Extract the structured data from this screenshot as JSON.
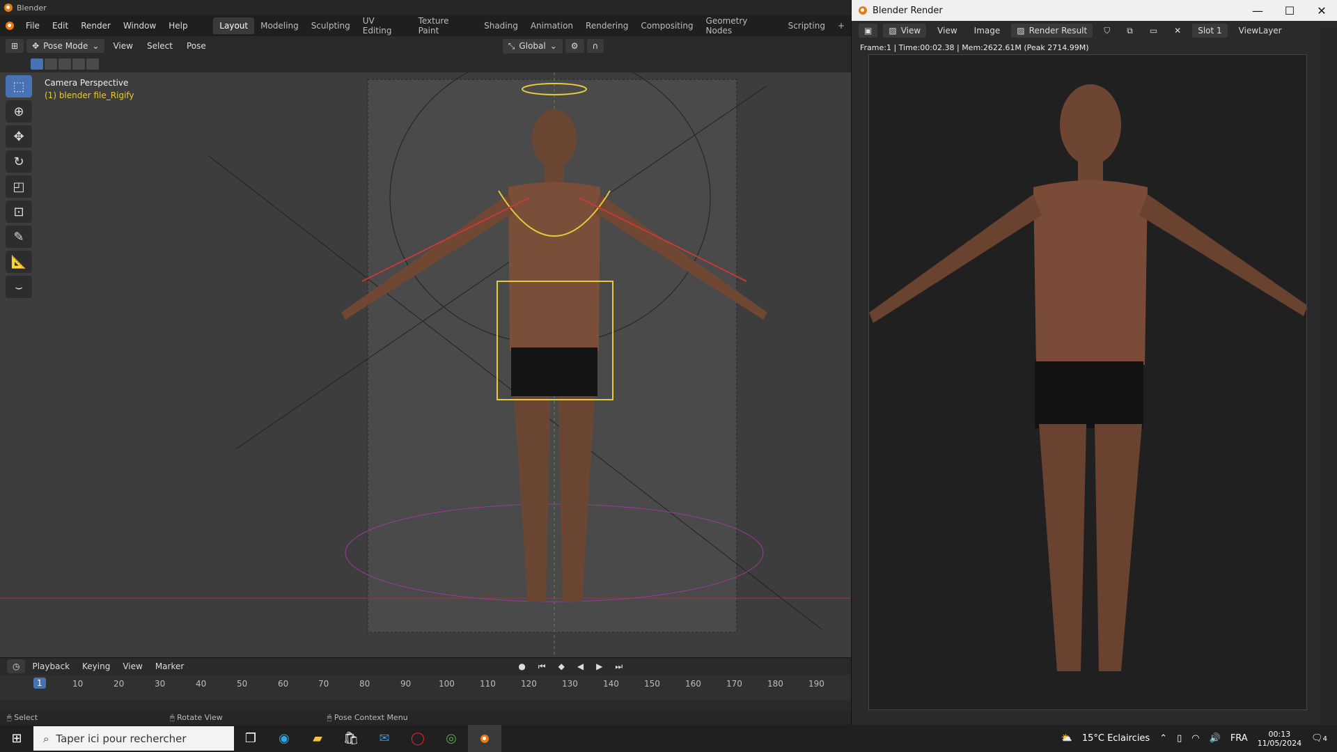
{
  "app": {
    "title": "Blender"
  },
  "menu": [
    "File",
    "Edit",
    "Render",
    "Window",
    "Help"
  ],
  "workspaces": [
    "Layout",
    "Modeling",
    "Sculpting",
    "UV Editing",
    "Texture Paint",
    "Shading",
    "Animation",
    "Rendering",
    "Compositing",
    "Geometry Nodes",
    "Scripting",
    "+"
  ],
  "header": {
    "mode": "Pose Mode",
    "items": [
      "View",
      "Select",
      "Pose"
    ],
    "orientation": "Global"
  },
  "viewport": {
    "label1": "Camera Perspective",
    "label2": "(1) blender file_Rigify"
  },
  "timeline": {
    "menus": [
      "Playback",
      "Keying",
      "View",
      "Marker"
    ],
    "current_frame": "1",
    "ticks": [
      "10",
      "20",
      "30",
      "40",
      "50",
      "60",
      "70",
      "80",
      "90",
      "100",
      "110",
      "120",
      "130",
      "140",
      "150",
      "160",
      "170",
      "180",
      "190"
    ]
  },
  "status": {
    "select": "Select",
    "rotate": "Rotate View",
    "context": "Pose Context Menu"
  },
  "render_window": {
    "title": "Blender Render",
    "menus": [
      "View",
      "View",
      "Image"
    ],
    "result": "Render Result",
    "slot": "Slot 1",
    "layer": "ViewLayer",
    "info": "Frame:1 | Time:00:02.38 | Mem:2622.61M (Peak 2714.99M)"
  },
  "taskbar": {
    "search_placeholder": "Taper ici pour rechercher",
    "weather": "15°C  Eclaircies",
    "lang": "FRA",
    "time": "00:13",
    "date": "11/05/2024",
    "notif_count": "4"
  },
  "colors": {
    "accent": "#4772b3",
    "orange": "#e87d0d"
  }
}
